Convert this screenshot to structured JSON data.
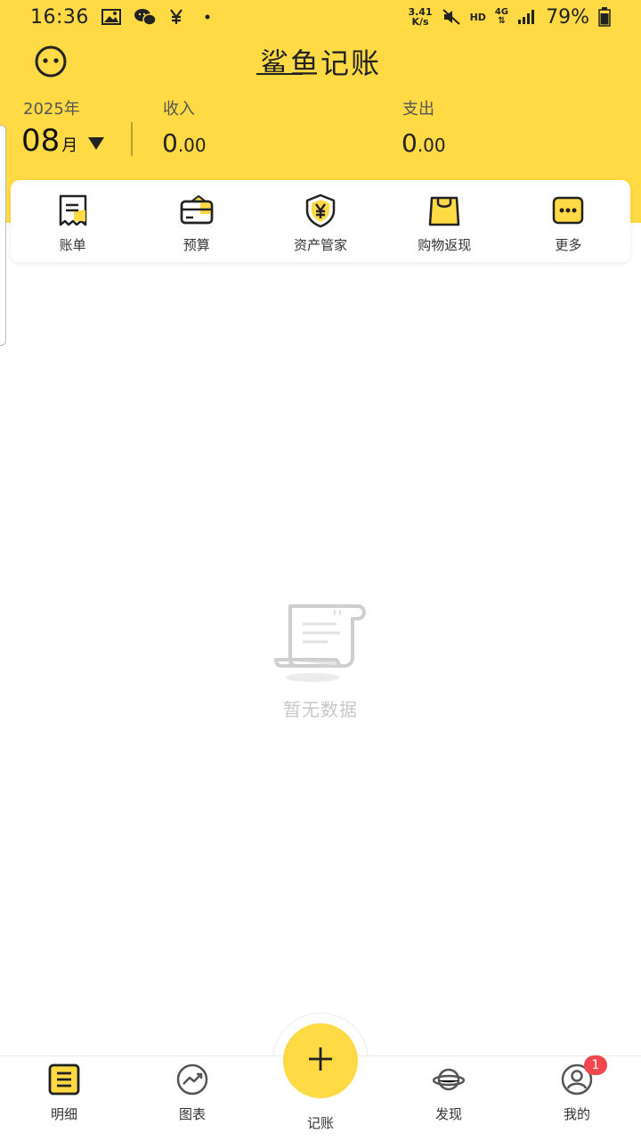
{
  "status_bar": {
    "time": "16:36",
    "net_speed_value": "3.41",
    "net_speed_unit": "K/s",
    "hd": "HD",
    "network": "4G",
    "battery": "79%",
    "icons": [
      "image-icon",
      "wechat-icon",
      "yen-icon",
      "dot-icon",
      "mute-icon",
      "signal-icon",
      "battery-icon"
    ]
  },
  "header": {
    "title": "鲨鱼记账",
    "year": "2025年",
    "month": "08",
    "month_unit": "月",
    "income_label": "收入",
    "income_int": "0",
    "income_dec": ".00",
    "expense_label": "支出",
    "expense_int": "0",
    "expense_dec": ".00"
  },
  "quick_actions": [
    {
      "label": "账单",
      "icon": "bill-icon"
    },
    {
      "label": "预算",
      "icon": "budget-icon"
    },
    {
      "label": "资产管家",
      "icon": "asset-icon"
    },
    {
      "label": "购物返现",
      "icon": "shopping-bag-icon"
    },
    {
      "label": "更多",
      "icon": "more-icon"
    }
  ],
  "empty_state": {
    "text": "暂无数据",
    "icon": "receipt-scroll-icon"
  },
  "bottom_nav": [
    {
      "label": "明细",
      "icon": "list-icon",
      "active": true
    },
    {
      "label": "图表",
      "icon": "chart-icon"
    },
    {
      "label": "记账",
      "icon": "plus-icon"
    },
    {
      "label": "发现",
      "icon": "planet-icon"
    },
    {
      "label": "我的",
      "icon": "user-icon",
      "badge": "1"
    }
  ],
  "colors": {
    "brand_yellow": "#FFDA44",
    "badge_red": "#F2474E"
  }
}
